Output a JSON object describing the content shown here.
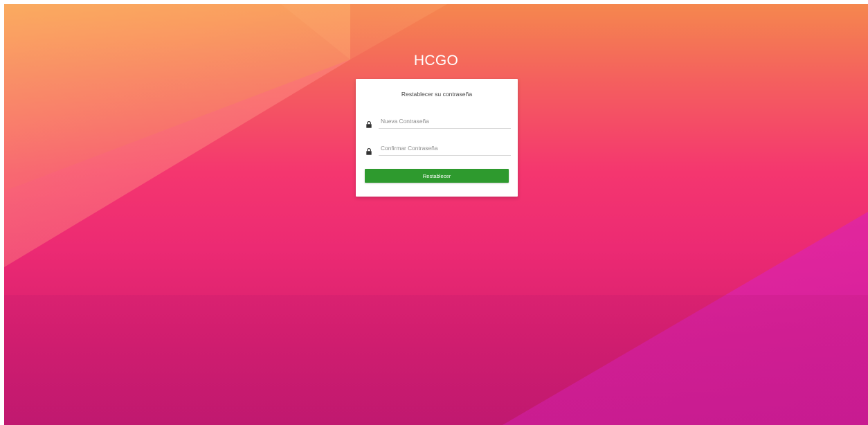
{
  "app": {
    "title": "HCGO"
  },
  "reset_card": {
    "heading": "Restablecer su contraseña",
    "new_password": {
      "placeholder": "Nueva Contraseña",
      "value": "",
      "icon": "lock-icon"
    },
    "confirm_password": {
      "placeholder": "Confirmar Contraseña",
      "value": "",
      "icon": "lock-icon"
    },
    "submit_label": "Restablecer"
  },
  "colors": {
    "background_top": "#f5874e",
    "background_mid": "#f4366f",
    "background_bottom": "#c41a70",
    "button": "#2e9a2e",
    "card": "#ffffff"
  }
}
